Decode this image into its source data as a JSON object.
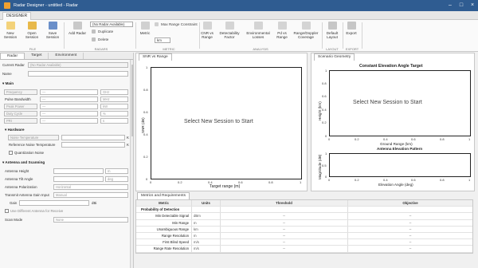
{
  "window": {
    "title": "Radar Designer - untitled - Radar"
  },
  "ribbon": {
    "main_tab": "DESIGNER",
    "file": {
      "new_session": "New Session",
      "open_session": "Open Session",
      "save_session": "Save Session",
      "group": "FILE"
    },
    "radars": {
      "add_radar": "Add Radar",
      "radar_select": "(No Radar Available)",
      "duplicate": "Duplicate",
      "delete": "Delete",
      "group": "RADARS"
    },
    "metric": {
      "metric_label": "Metric",
      "max_range_constraint": "Max Range Constraint",
      "unit": "km",
      "group": "METRIC"
    },
    "analysis": {
      "cnr_vs_range": "CNR vs Range",
      "detectability_factor": "Detectability Factor",
      "environmental_losses": "Environmental Losses",
      "pd_vs_range": "Pd vs Range",
      "range_doppler_coverage": "Range/Doppler Coverage",
      "group": "ANALYSIS"
    },
    "layout": {
      "default_layout": "Default Layout",
      "group": "LAYOUT"
    },
    "export": {
      "export": "Export",
      "group": "EXPORT"
    },
    "colors": {
      "titlebar": "#2f5c91"
    }
  },
  "left_panel": {
    "tabs": [
      "Radar",
      "Target",
      "Environment"
    ],
    "current_radar_label": "Current Radar",
    "current_radar_value": "(No Radar Available)",
    "name_label": "Name",
    "main_section": "Main",
    "main_fields": [
      {
        "label": "Frequency",
        "value": "—",
        "unit": "GHz"
      },
      {
        "label": "Pulse Bandwidth",
        "value": "—",
        "unit": "MHz"
      },
      {
        "label": "Peak Power",
        "value": "—",
        "unit": "kW"
      },
      {
        "label": "Duty Cycle",
        "value": "—",
        "unit": "%"
      },
      {
        "label": "PRI",
        "value": "—",
        "unit": "s"
      }
    ],
    "hardware_section": "Hardware",
    "noise_temperature": "Noise Temperature",
    "reference_noise_temperature": "Reference Noise Temperature",
    "noise_temp_unit": "K",
    "quantization_noise": "Quantization Noise",
    "antenna_section": "Antenna and Scanning",
    "antenna_height": "Antenna Height",
    "antenna_height_unit": "m",
    "antenna_tilt": "Antenna Tilt Angle",
    "antenna_tilt_unit": "deg",
    "antenna_polarization": "Antenna Polarization",
    "antenna_polarization_value": "Horizontal",
    "transmit_gain_input": "Transmit Antenna Gain Input",
    "transmit_gain_value": "Manual",
    "gain_label": "Gain",
    "gain_unit": "dBi",
    "use_different_antenna": "Use Different Antenna for Receive",
    "scan_mode": "Scan Mode",
    "scan_mode_value": "None"
  },
  "snr_panel": {
    "tab": "SNR vs Range",
    "message": "Select New Session to Start",
    "ylabel": "SNR (dB)",
    "xlabel": "Target range (m)",
    "xticks": [
      "0",
      "0.2",
      "0.4",
      "0.6",
      "0.8",
      "1"
    ],
    "yticks": [
      "1",
      "0.8",
      "0.6",
      "0.4",
      "0.2",
      "0"
    ]
  },
  "scenario_panel": {
    "tab": "Scenario Geometry",
    "top_title": "Constant Elevation Angle Target",
    "message": "Select New Session to Start",
    "top_ylabel": "Height (km)",
    "top_xlabel": "Ground Range (km)",
    "top_xticks": [
      "0",
      "0.2",
      "0.4",
      "0.6",
      "0.8",
      "1"
    ],
    "top_yticks": [
      "1",
      "0.8",
      "0.6",
      "0.4",
      "0.2",
      "0"
    ],
    "bottom_title": "Antenna Elevation Pattern",
    "bottom_ylabel": "Magnitude (dB)",
    "bottom_xlabel": "Elevation Angle (deg)",
    "bottom_xticks": [
      "0",
      "0.2",
      "0.4",
      "0.6",
      "0.8",
      "1"
    ],
    "bottom_yticks": [
      "1",
      "0.5",
      "0"
    ]
  },
  "metrics_table": {
    "tab": "Metrics and Requirements",
    "headers": [
      "Metric",
      "Units",
      "Threshold",
      "Objective"
    ],
    "section": "Probability of Detection",
    "rows": [
      {
        "metric": "Min Detectable Signal",
        "units": "dBm",
        "threshold": "--",
        "objective": "--"
      },
      {
        "metric": "Min Range",
        "units": "m",
        "threshold": "--",
        "objective": "--"
      },
      {
        "metric": "Unambiguous Range",
        "units": "km",
        "threshold": "--",
        "objective": "--"
      },
      {
        "metric": "Range Resolution",
        "units": "m",
        "threshold": "--",
        "objective": "--"
      },
      {
        "metric": "First Blind Speed",
        "units": "m/s",
        "threshold": "--",
        "objective": "--"
      },
      {
        "metric": "Range Rate Resolution",
        "units": "m/s",
        "threshold": "--",
        "objective": "--"
      }
    ]
  }
}
